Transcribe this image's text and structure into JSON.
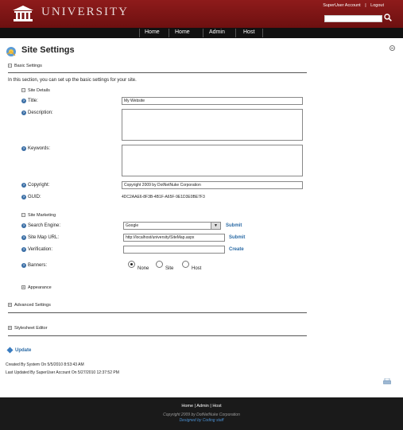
{
  "header": {
    "brand": "UNIVERSITY",
    "user_name": "SuperUser Account",
    "logout": "Logout",
    "search_placeholder": ""
  },
  "nav": {
    "items": [
      "Home",
      "Home",
      "Admin",
      "Host"
    ]
  },
  "page": {
    "title": "Site Settings"
  },
  "basic": {
    "section_label": "Basic Settings",
    "intro": "In this section, you can set up the basic settings for your site.",
    "site_details_label": "Site Details",
    "title_label": "Title:",
    "title_value": "My Website",
    "description_label": "Description:",
    "description_value": "",
    "keywords_label": "Keywords:",
    "keywords_value": "",
    "copyright_label": "Copyright:",
    "copyright_value": "Copyright 2009 by DotNetNuke Corporation",
    "guid_label": "GUID:",
    "guid_value": "4DC2AAE6-8F3B-4B1F-A65F-9E1D3E0BE7F3",
    "marketing_label": "Site Marketing",
    "search_engine_label": "Search Engine:",
    "search_engine_value": "Google",
    "submit_label": "Submit",
    "sitemap_label": "Site Map URL:",
    "sitemap_value": "http://localhost/university/SiteMap.aspx",
    "submit2_label": "Submit",
    "verification_label": "Verification:",
    "verification_value": "",
    "create_label": "Create",
    "banners_label": "Banners:",
    "banner_options": [
      "None",
      "Site",
      "Host"
    ],
    "appearance_label": "Appearance"
  },
  "advanced": {
    "section_label": "Advanced Settings"
  },
  "stylesheet": {
    "section_label": "Stylesheet Editor"
  },
  "actions": {
    "update_label": "Update"
  },
  "audit": {
    "created": "Created By System On 5/5/2010 8:53:43 AM",
    "updated": "Last Updated By SuperUser Account On 5/27/2010 12:37:52 PM"
  },
  "footer": {
    "links": [
      "Home",
      "Admin",
      "Host"
    ],
    "copyright": "Copyright 2009 by DotNetNuke Corporation",
    "designed": "Designed by Coding staff"
  }
}
